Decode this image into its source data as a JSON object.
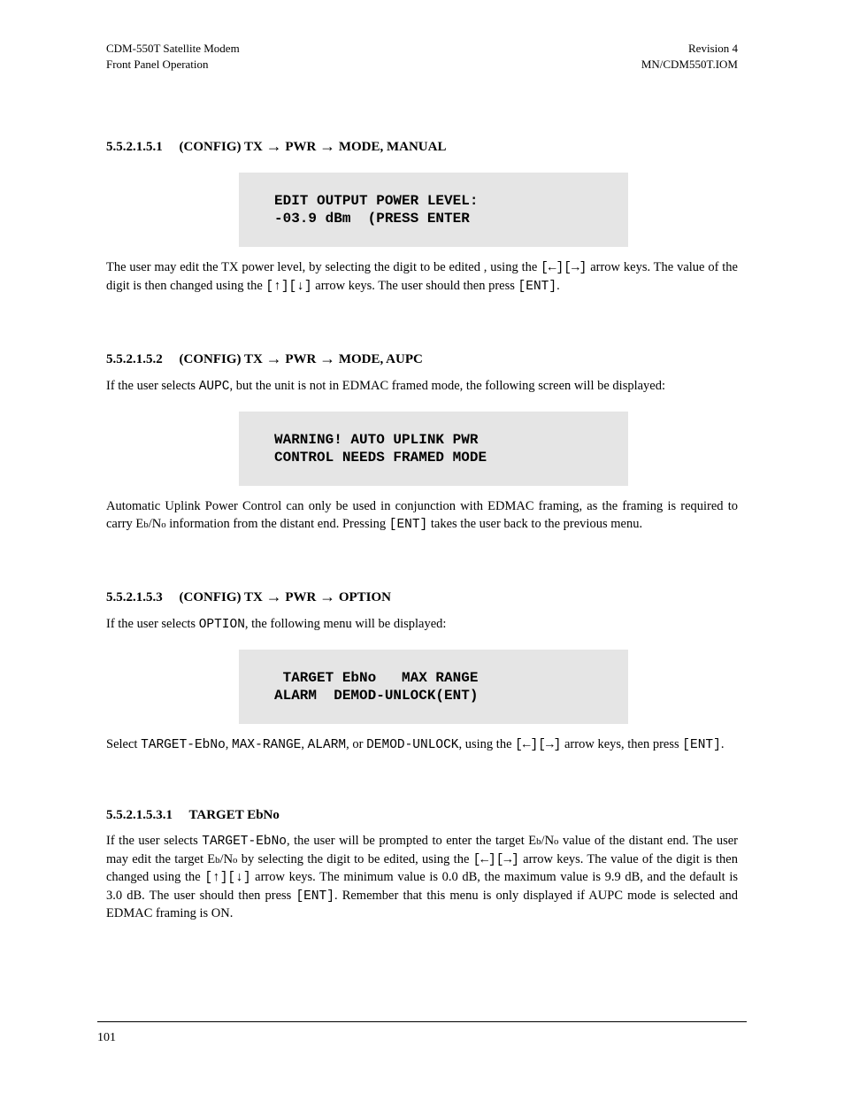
{
  "header": {
    "left_line1": "CDM-550T Satellite Modem",
    "left_line2": "Front Panel Operation",
    "right_line1": "Revision 4",
    "right_line2": "MN/CDM550T.IOM"
  },
  "sections": {
    "manual_mode": {
      "number": "5.5.2.1.5.1",
      "trail_prefix": "(CONFIG) TX ",
      "trail_mid": " PWR ",
      "trail_end": " MODE, MANUAL",
      "lcd_l1": "EDIT OUTPUT POWER LEVEL:",
      "lcd_l2": "-03.9 dBm  (PRESS ENTER",
      "para1_a": "The user may edit the TX power level, by selecting the digit to be edited , using the ",
      "para1_b": " arrow keys. The value of the digit is then changed using the ",
      "para1_c": " arrow keys. The user should then press ",
      "para1_d": "."
    },
    "aupc_mode": {
      "number": "5.5.2.1.5.2",
      "trail_prefix": "(CONFIG) TX ",
      "trail_mid": " PWR ",
      "trail_end": " MODE, AUPC",
      "para0_a": "If the user selects ",
      "para0_b": ", but the unit is not in EDMAC framed mode, the following screen will be displayed:",
      "lcd_l1": "WARNING! AUTO UPLINK PWR",
      "lcd_l2": "CONTROL NEEDS FRAMED MODE",
      "para1_a": "Automatic Uplink Power Control can only be used in conjunction with EDMAC framing, as the framing is required to carry E",
      "para1_b": "/N",
      "para1_c": " information from the distant end. Pressing ",
      "para1_d": " takes the user back to the previous menu."
    },
    "option_mode": {
      "number": "5.5.2.1.5.3",
      "trail_prefix": "(CONFIG) TX ",
      "trail_mid": " PWR ",
      "trail_end": " OPTION",
      "para0_a": "If the user selects ",
      "para0_b": ", the following menu will be displayed:",
      "lcd_l1": " TARGET EbNo   MAX RANGE",
      "lcd_l2": "ALARM  DEMOD-UNLOCK(ENT)",
      "para1_a": "Select ",
      "para1_b": ", ",
      "para1_c": ", ",
      "para1_d": ", or ",
      "para1_e": ", using the ",
      "para1_f": " arrow keys, then press ",
      "para1_g": "."
    },
    "target_ebno": {
      "number": "5.5.2.1.5.3.1",
      "title_suffix": "TARGET EbNo",
      "para0_a": "If the user selects ",
      "para0_b": ", the user will be prompted to enter the target E",
      "para0_c": "/N",
      "para0_d": " value of the distant end. The user may edit the target E",
      "para0_e": "/N",
      "para0_f": " by selecting the digit to be edited, using the ",
      "para0_g": " arrow keys. The value of the digit is then changed using the ",
      "para0_h": " arrow keys. The minimum value is 0.0 dB, the maximum value is 9.9 dB, and the default is 3.0 dB. The user should then press ",
      "para0_i": ". Remember that this menu is only displayed if AUPC mode is selected and EDMAC framing is ON."
    }
  },
  "keys": {
    "left": "[←]",
    "right": "[→]",
    "up": "[↑]",
    "down": "[↓]",
    "enter": "[ENT]"
  },
  "labels": {
    "aupc": "AUPC",
    "option": "OPTION",
    "target_ebno": "TARGET-EbNo",
    "max_range": "MAX-RANGE",
    "alarm": "ALARM",
    "demod_unlock": "DEMOD-UNLOCK"
  },
  "footer": {
    "left": "101",
    "right": ""
  }
}
